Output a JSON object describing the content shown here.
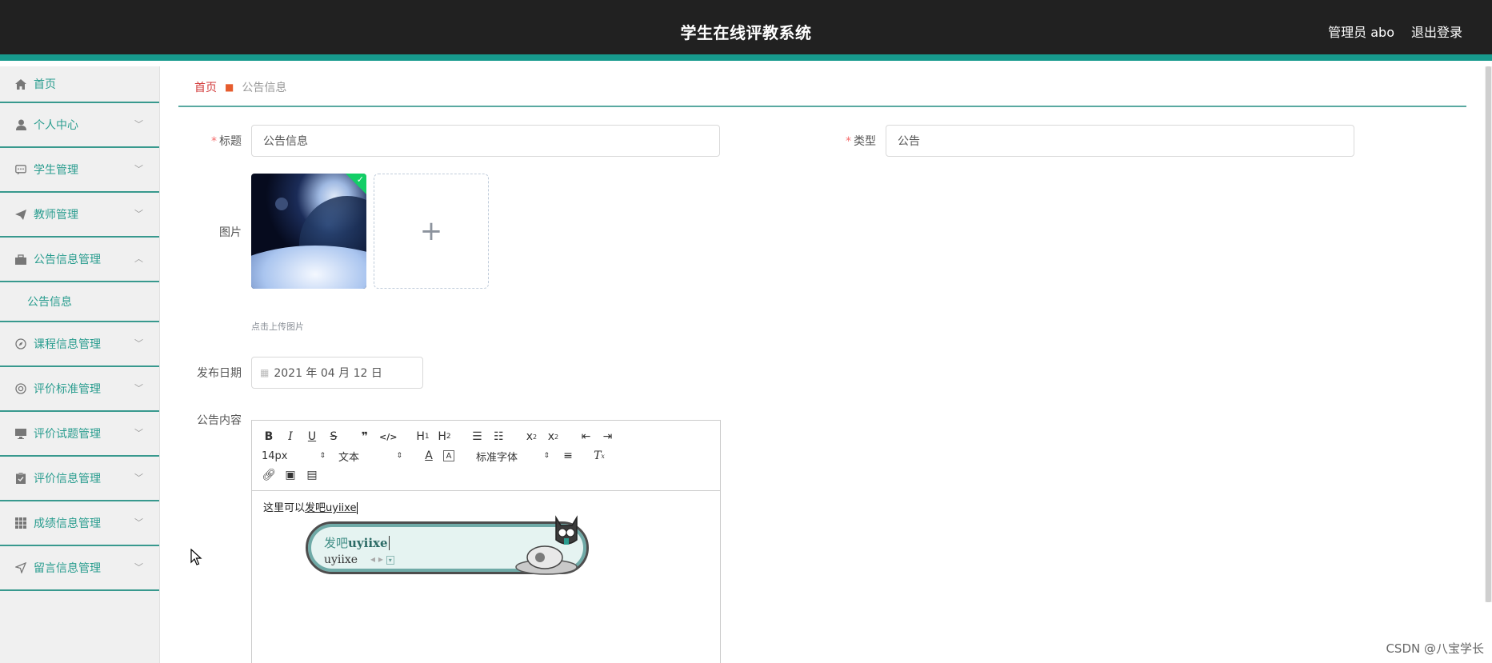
{
  "header": {
    "title": "学生在线评教系统",
    "user_label": "管理员 abo",
    "logout_label": "退出登录"
  },
  "sidebar": {
    "items": [
      {
        "label": "首页",
        "icon": "home-icon"
      },
      {
        "label": "个人中心",
        "icon": "user-icon"
      },
      {
        "label": "学生管理",
        "icon": "chat-icon"
      },
      {
        "label": "教师管理",
        "icon": "paper-plane-icon"
      },
      {
        "label": "公告信息管理",
        "icon": "briefcase-icon",
        "sub": "公告信息"
      },
      {
        "label": "课程信息管理",
        "icon": "compass-icon"
      },
      {
        "label": "评价标准管理",
        "icon": "lifebuoy-icon"
      },
      {
        "label": "评价试题管理",
        "icon": "monitor-icon"
      },
      {
        "label": "评价信息管理",
        "icon": "clipboard-icon"
      },
      {
        "label": "成绩信息管理",
        "icon": "grid-icon"
      },
      {
        "label": "留言信息管理",
        "icon": "send-icon"
      }
    ]
  },
  "breadcrumb": {
    "home": "首页",
    "current": "公告信息"
  },
  "form": {
    "title_label": "标题",
    "title_value": "公告信息",
    "type_label": "类型",
    "type_value": "公告",
    "image_label": "图片",
    "upload_tip": "点击上传图片",
    "date_label": "发布日期",
    "date_value": "2021 年 04 月 12 日",
    "content_label": "公告内容"
  },
  "editor": {
    "size_select": "14px",
    "format_select": "文本",
    "font_select": "标准字体",
    "content_prefix": "这里可以",
    "content_underlined": "发吧uyiixe"
  },
  "ime": {
    "composition_prefix": "发吧",
    "composition_bold": "uyiixe",
    "candidate": "uyiixe"
  },
  "watermark": "CSDN @八宝学长"
}
